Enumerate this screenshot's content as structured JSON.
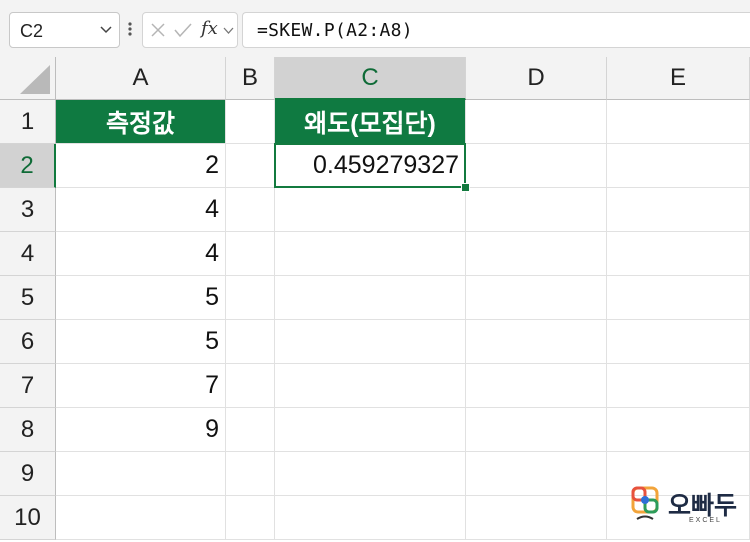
{
  "formula_bar": {
    "name_box": "C2",
    "fx_label": "fx",
    "formula": "=SKEW.P(A2:A8)"
  },
  "columns": [
    "A",
    "B",
    "C",
    "D",
    "E"
  ],
  "selected_column": "C",
  "rows": [
    "1",
    "2",
    "3",
    "4",
    "5",
    "6",
    "7",
    "8",
    "9",
    "10"
  ],
  "selected_row": "2",
  "cells": {
    "A1": "측정값",
    "C1": "왜도(모집단)",
    "A2": "2",
    "A3": "4",
    "A4": "4",
    "A5": "5",
    "A6": "5",
    "A7": "7",
    "A8": "9",
    "C2": "0.459279327"
  },
  "logo": {
    "word": "오빠두",
    "sub": "EXCEL"
  },
  "colors": {
    "header_fill": "#0f7a41",
    "selection": "#137a3f"
  }
}
